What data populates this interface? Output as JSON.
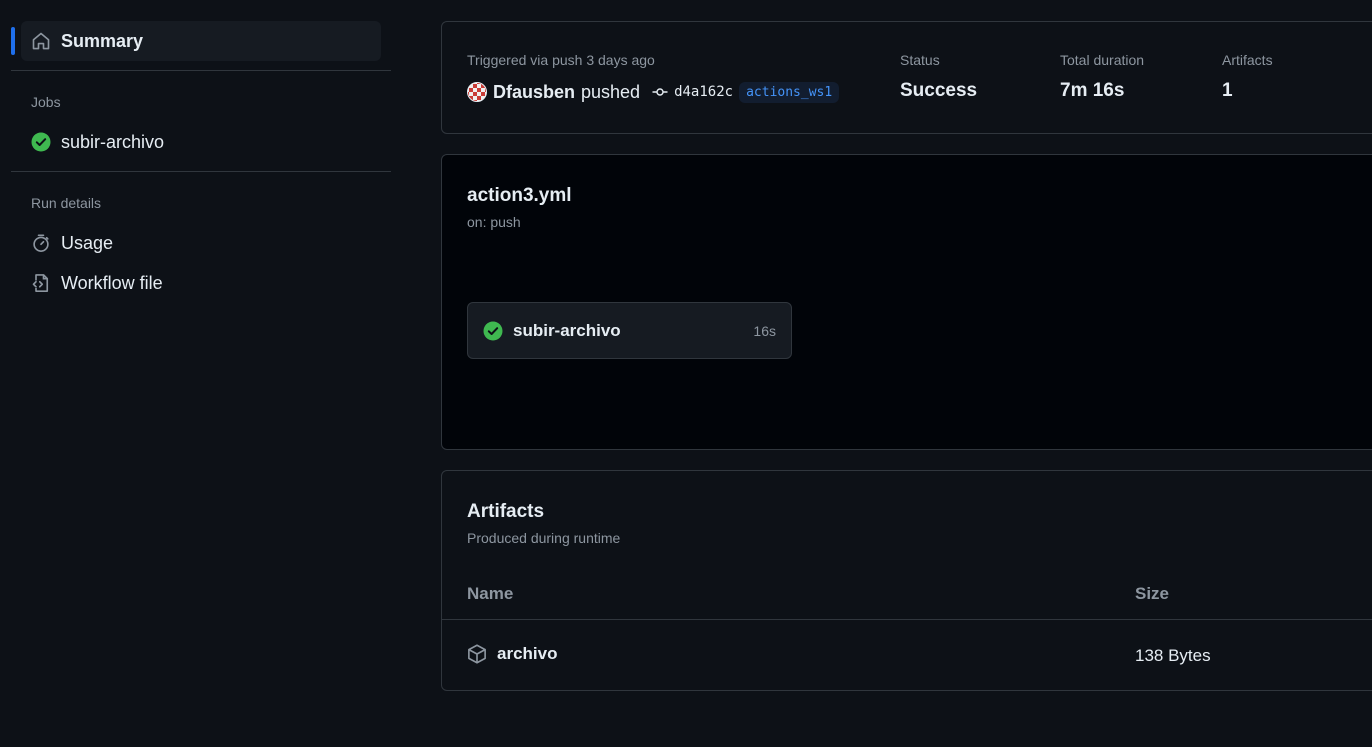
{
  "sidebar": {
    "summary_label": "Summary",
    "jobs_heading": "Jobs",
    "jobs": [
      {
        "label": "subir-archivo",
        "status": "success"
      }
    ],
    "run_details_heading": "Run details",
    "usage_label": "Usage",
    "workflow_file_label": "Workflow file"
  },
  "summary": {
    "triggered_text": "Triggered via push 3 days ago",
    "username": "Dfausben",
    "pushed_text": "pushed",
    "commit_sha": "d4a162c",
    "branch": "actions_ws1",
    "status_label": "Status",
    "status_value": "Success",
    "duration_label": "Total duration",
    "duration_value": "7m 16s",
    "artifacts_label": "Artifacts",
    "artifacts_value": "1"
  },
  "workflow": {
    "file_name": "action3.yml",
    "trigger": "on: push",
    "job": {
      "name": "subir-archivo",
      "duration": "16s"
    }
  },
  "artifacts": {
    "title": "Artifacts",
    "subtitle": "Produced during runtime",
    "columns": {
      "name": "Name",
      "size": "Size"
    },
    "rows": [
      {
        "name": "archivo",
        "size": "138 Bytes"
      }
    ]
  },
  "colors": {
    "accent": "#1f6feb",
    "success": "#3fb950",
    "link": "#4493f8"
  }
}
